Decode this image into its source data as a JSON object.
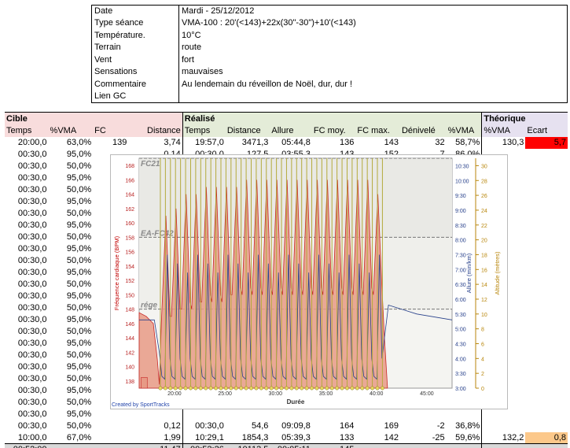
{
  "info": [
    {
      "k": "Date",
      "v": "Mardi - 25/12/2012"
    },
    {
      "k": "Type séance",
      "v": "VMA-100 : 20'(<143)+22x(30\"-30\")+10'(<143)"
    },
    {
      "k": "Température.",
      "v": "10°C"
    },
    {
      "k": "Terrain",
      "v": "route"
    },
    {
      "k": "Vent",
      "v": "fort"
    },
    {
      "k": "Sensations",
      "v": "mauvaises"
    },
    {
      "k": "Commentaire",
      "v": "Au lendemain du réveillon de Noël, dur, dur !"
    },
    {
      "k": "Lien GC",
      "v": ""
    }
  ],
  "sections": {
    "cible": "Cible",
    "realise": "Réalisé",
    "theorique": "Théorique"
  },
  "headers": {
    "cible": [
      "Temps",
      "%VMA",
      "FC",
      "Distance"
    ],
    "realise": [
      "Temps",
      "Distance",
      "Allure",
      "FC moy.",
      "FC max.",
      "Dénivelé",
      "%VMA"
    ],
    "theorique": [
      "%VMA",
      "Ecart"
    ]
  },
  "row_first": [
    "20:00,0",
    "63,0%",
    "139",
    "3,74",
    "19:57,0",
    "3471,3",
    "05:44,8",
    "136",
    "143",
    "32",
    "58,7%",
    "130,3",
    "5,7"
  ],
  "row_second": [
    "00:30,0",
    "95,0%",
    "",
    "0,14",
    "00:30,0",
    "127,5",
    "03:55,3",
    "143",
    "152",
    "7",
    "86,0%",
    "",
    ""
  ],
  "cible_rows": [
    [
      "00:30,0",
      "50,0%"
    ],
    [
      "00:30,0",
      "95,0%"
    ],
    [
      "00:30,0",
      "50,0%"
    ],
    [
      "00:30,0",
      "95,0%"
    ],
    [
      "00:30,0",
      "50,0%"
    ],
    [
      "00:30,0",
      "95,0%"
    ],
    [
      "00:30,0",
      "50,0%"
    ],
    [
      "00:30,0",
      "95,0%"
    ],
    [
      "00:30,0",
      "50,0%"
    ],
    [
      "00:30,0",
      "95,0%"
    ],
    [
      "00:30,0",
      "50,0%"
    ],
    [
      "00:30,0",
      "95,0%"
    ],
    [
      "00:30,0",
      "50,0%"
    ],
    [
      "00:30,0",
      "95,0%"
    ],
    [
      "00:30,0",
      "50,0%"
    ],
    [
      "00:30,0",
      "95,0%"
    ],
    [
      "00:30,0",
      "50,0%"
    ],
    [
      "00:30,0",
      "95,0%"
    ],
    [
      "00:30,0",
      "50,0%"
    ],
    [
      "00:30,0",
      "95,0%"
    ],
    [
      "00:30,0",
      "50,0%"
    ],
    [
      "00:30,0",
      "95,0%"
    ]
  ],
  "row_last_int": [
    "00:30,0",
    "50,0%",
    "",
    "0,12",
    "00:30,0",
    "54,6",
    "09:09,8",
    "164",
    "169",
    "-2",
    "36,8%",
    "",
    ""
  ],
  "row_cool": [
    "10:00,0",
    "67,0%",
    "",
    "1,99",
    "10:29,1",
    "1854,3",
    "05:39,3",
    "133",
    "142",
    "-25",
    "59,6%",
    "132,2",
    "0,8"
  ],
  "row_total": [
    "00:52:00",
    "",
    "",
    "11,47",
    "00:52:26",
    "10113,5",
    "00:05:11",
    "145",
    "",
    "",
    "",
    "",
    ""
  ],
  "chart_data": {
    "type": "line",
    "xlabel": "Durée",
    "ylabel_left": "Fréquence cardiaque (BPM)",
    "ylabel_right1": "Allure (min/km)",
    "ylabel_right2": "Altitude (mètres)",
    "x_ticks": [
      "20:00",
      "25:00",
      "30:00",
      "35:00",
      "40:00",
      "45:00"
    ],
    "x_tick_values": [
      20,
      25,
      30,
      35,
      40,
      45
    ],
    "xlim": [
      16.5,
      47.5
    ],
    "hr_ticks": [
      138,
      140,
      142,
      144,
      146,
      148,
      150,
      152,
      154,
      156,
      158,
      160,
      162,
      164,
      166,
      168
    ],
    "ylim_hr": [
      137,
      169
    ],
    "pace_ticks": [
      "3:00",
      "3:30",
      "4:00",
      "4:30",
      "5:00",
      "5:30",
      "6:00",
      "6:30",
      "7:00",
      "7:30",
      "8:00",
      "8:30",
      "9:00",
      "9:30",
      "10:00",
      "10:30"
    ],
    "alt_ticks": [
      0,
      2,
      4,
      6,
      8,
      10,
      12,
      14,
      16,
      18,
      20,
      22,
      24,
      26,
      28,
      30
    ],
    "zones": [
      {
        "name": "FC21",
        "hr": 169
      },
      {
        "name": "EA-FC42",
        "hr": 158
      },
      {
        "name": "rége",
        "hr": 148
      }
    ],
    "credit": "Created by SportTracks",
    "hr_peaks": [
      161,
      162,
      164,
      164,
      165,
      165,
      165,
      165,
      166,
      166,
      166,
      166,
      166,
      166,
      166,
      166,
      166,
      166,
      166,
      166,
      166,
      164
    ],
    "hr_troughs": [
      146,
      147,
      148,
      148,
      149,
      149,
      149,
      150,
      150,
      150,
      150,
      150,
      150,
      150,
      150,
      150,
      150,
      150,
      150,
      150,
      150,
      150
    ],
    "interval_start": 18.6,
    "interval_period": 1.0,
    "interval_end": 40.8
  },
  "colors": {
    "red": "#ff0000",
    "orange": "#fcc88a",
    "hr_fill": "#e79a86",
    "hr_line": "#c82828",
    "pace_line": "#27408b",
    "marker": "#b4aa3c"
  }
}
